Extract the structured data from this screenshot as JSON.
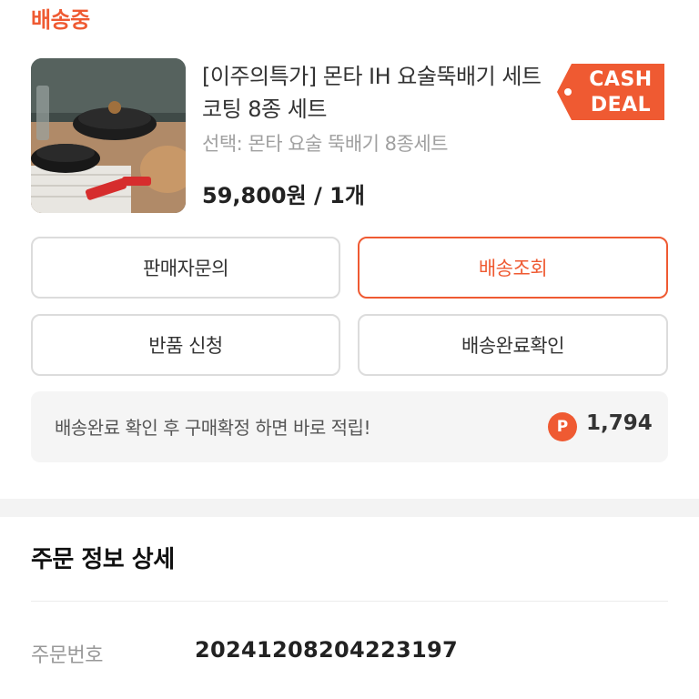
{
  "order": {
    "status_title": "배송중",
    "product": {
      "name": "[이주의특가] 몬타 IH 요술뚝배기 세트 코팅 8종 세트",
      "option": "선택: 몬타 요술 뚝배기 8종세트",
      "price": "59,800원 / 1개",
      "badge": {
        "line1": "CASH",
        "line2": "DEAL",
        "color": "#ef5a32"
      }
    }
  },
  "actions": {
    "seller_inquiry": "판매자문의",
    "track_delivery": "배송조회",
    "return_request": "반품 신청",
    "confirm_delivery": "배송완료확인"
  },
  "reward": {
    "message": "배송완료 확인 후 구매확정 하면 바로 적립!",
    "icon": "point-icon",
    "icon_letter": "P",
    "points": "1,794"
  },
  "order_detail": {
    "title": "주문 정보 상세",
    "fields": [
      {
        "label": "주문번호",
        "value": "20241208204223197"
      }
    ]
  },
  "theme": {
    "accent": "#ef5a32",
    "border": "#dcdcdc",
    "notice_bg": "#f5f5f5"
  }
}
